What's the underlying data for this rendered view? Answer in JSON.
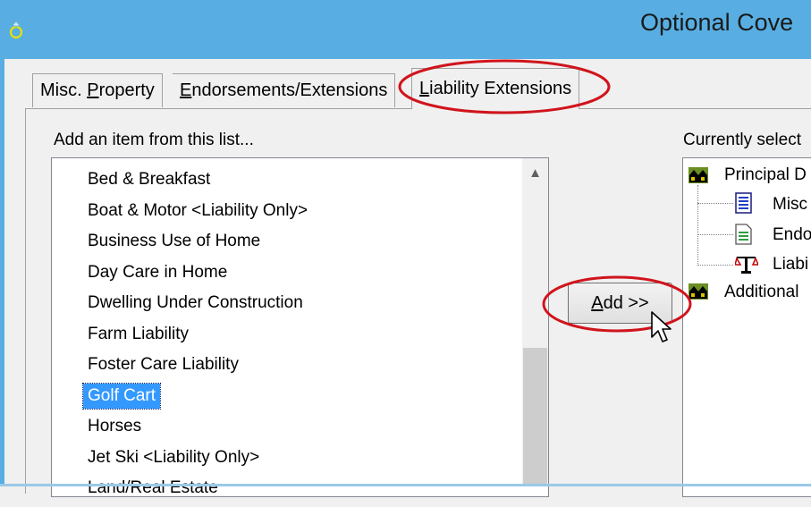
{
  "window": {
    "title": "Optional Cove",
    "icon": "app-ring-icon"
  },
  "tabs": [
    {
      "label_pre": "Misc. ",
      "label_u": "P",
      "label_post": "roperty"
    },
    {
      "label_pre": "",
      "label_u": "E",
      "label_post": "ndorsements/Extensions"
    },
    {
      "label_pre": "",
      "label_u": "L",
      "label_post": "iability Extensions",
      "active": true
    }
  ],
  "available": {
    "label": "Add an item from this list...",
    "items": [
      "Bed & Breakfast",
      "Boat & Motor <Liability Only>",
      "Business Use of Home",
      "Day Care in Home",
      "Dwelling Under Construction",
      "Farm Liability",
      "Foster Care Liability",
      "Golf Cart",
      "Horses",
      "Jet Ski <Liability Only>",
      "Land/Real Estate"
    ],
    "selected": "Golf Cart"
  },
  "add_button": {
    "label_u": "A",
    "label_post": "dd >>"
  },
  "selected_panel": {
    "label": "Currently select",
    "tree": {
      "root1": "Principal D",
      "child1": "Misc",
      "child2": "Endo",
      "child3": "Liabi",
      "root2": "Additional"
    }
  },
  "colors": {
    "titlebar": "#58aee2",
    "selection": "#3399ff",
    "annotation": "#d0141c"
  }
}
